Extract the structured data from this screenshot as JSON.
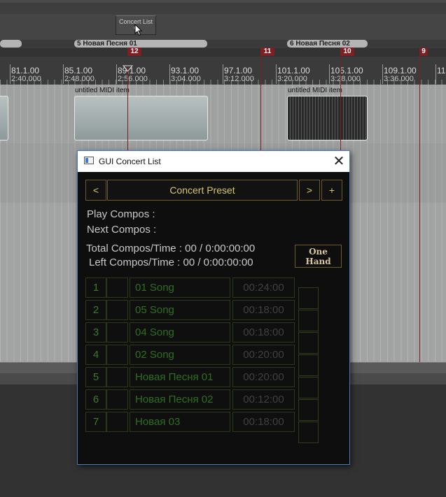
{
  "daw": {
    "concert_button": {
      "line1": "Concert List",
      "line2": "V"
    },
    "regions": [
      "5  Новая Песня 01",
      "6  Новая Песня 02"
    ],
    "markers": [
      "12",
      "11",
      "10",
      "9"
    ],
    "ruler": [
      {
        "bar": "81.1.00",
        "time": "2:40.000"
      },
      {
        "bar": "85.1.00",
        "time": "2:48.000"
      },
      {
        "bar": "89.1.00",
        "time": "2:56.000"
      },
      {
        "bar": "93.1.00",
        "time": "3:04.000"
      },
      {
        "bar": "97.1.00",
        "time": "3:12.000"
      },
      {
        "bar": "101.1.00",
        "time": "3:20.000"
      },
      {
        "bar": "105.1.00",
        "time": "3:28.000"
      },
      {
        "bar": "109.1.00",
        "time": "3:36.000"
      },
      {
        "bar": "11",
        "time": ""
      }
    ],
    "item_label": "untitled MIDI item",
    "colors": {
      "marker": "#7e1f23",
      "accent": "#d8c56a",
      "list_text": "#2f6e1e"
    }
  },
  "dialog": {
    "title": "GUI Concert List",
    "close_icon": "close-icon",
    "prev_label": "<",
    "preset_label": "Concert Preset",
    "next_label": ">",
    "add_label": "+",
    "play_compos": "Play Compos  :",
    "next_compos": "Next Compos :",
    "total": "Total Compos/Time : 00 / 0:00:00:00",
    "left": "Left Compos/Time  : 00 / 0:00:00:00",
    "one_hand": {
      "line1": "One",
      "line2": "Hand"
    },
    "songs": [
      {
        "num": "1",
        "name": "01 Song",
        "time": "00:24:00"
      },
      {
        "num": "2",
        "name": "05 Song",
        "time": "00:18:00"
      },
      {
        "num": "3",
        "name": "04 Song",
        "time": "00:18:00"
      },
      {
        "num": "4",
        "name": "02 Song",
        "time": "00:20:00"
      },
      {
        "num": "5",
        "name": "Новая Песня 01",
        "time": "00:20:00"
      },
      {
        "num": "6",
        "name": "Новая Песня 02",
        "time": "00:12:00"
      },
      {
        "num": "7",
        "name": "Новая 03",
        "time": "00:18:00"
      }
    ]
  }
}
